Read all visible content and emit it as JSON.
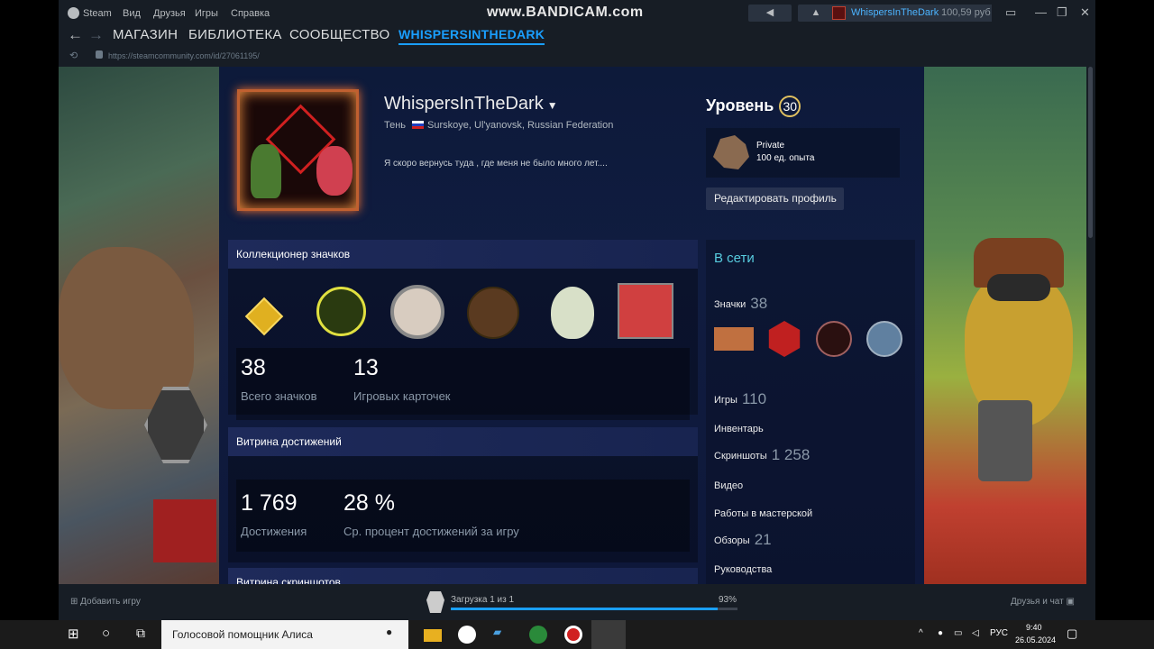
{
  "window": {
    "steam_menu": "Steam",
    "menu": [
      "Вид",
      "Друзья",
      "Игры",
      "Справка"
    ],
    "watermark": "www.BANDICAM.com",
    "account_name": "WhispersInTheDark",
    "balance": "100,59 руб"
  },
  "nav": {
    "tabs": [
      "МАГАЗИН",
      "БИБЛИОТЕКА",
      "СООБЩЕСТВО",
      "WHISPERSINTHEDARK"
    ],
    "url": "https://steamcommunity.com/id/27061195/"
  },
  "profile": {
    "name": "WhispersInTheDark",
    "realname": "Тень",
    "location": "Surskoye, Ul'yanovsk, Russian Federation",
    "summary": "Я скоро вернусь туда , где меня не было много лет....",
    "level_label": "Уровень",
    "level": "30",
    "fav_badge_name": "Private",
    "fav_badge_xp": "100 ед. опыта",
    "edit_button": "Редактировать профиль"
  },
  "badge_showcase": {
    "title": "Коллекционер значков",
    "total": "38",
    "total_label": "Всего значков",
    "cards": "13",
    "cards_label": "Игровых карточек"
  },
  "ach_showcase": {
    "title": "Витрина достижений",
    "count": "1 769",
    "count_label": "Достижения",
    "avg": "28 %",
    "avg_label": "Ср. процент достижений за игру"
  },
  "screenshot_showcase": {
    "title": "Витрина скриншотов"
  },
  "sidebar": {
    "status": "В сети",
    "badges_label": "Значки",
    "badges_count": "38",
    "games_label": "Игры",
    "games_count": "110",
    "inventory_label": "Инвентарь",
    "screenshots_label": "Скриншоты",
    "screenshots_count": "1 258",
    "videos_label": "Видео",
    "workshop_label": "Работы в мастерской",
    "reviews_label": "Обзоры",
    "reviews_count": "21",
    "guides_label": "Руководства"
  },
  "bottom": {
    "add_game": "Добавить игру",
    "download": "Загрузка 1 из 1",
    "download_pct": "93%",
    "download_progress": 0.93,
    "friends": "Друзья и чат"
  },
  "taskbar": {
    "search_placeholder": "Голосовой помощник Алиса",
    "lang": "РУС",
    "time": "9:40",
    "date": "26.05.2024"
  }
}
